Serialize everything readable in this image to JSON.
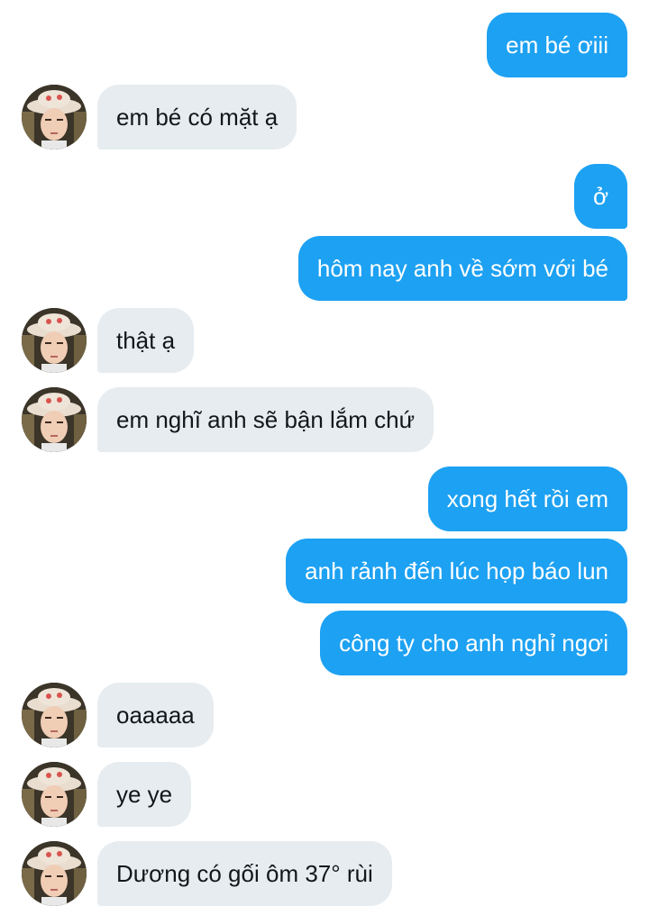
{
  "conversation": {
    "messages": [
      {
        "direction": "outgoing",
        "text": "em bé ơiii"
      },
      {
        "direction": "incoming",
        "text": "em bé có mặt ạ"
      },
      {
        "direction": "outgoing",
        "text": "ở"
      },
      {
        "direction": "outgoing",
        "text": "hôm nay anh về sớm với bé"
      },
      {
        "direction": "incoming",
        "text": "thật ạ"
      },
      {
        "direction": "incoming",
        "text": "em nghĩ anh sẽ bận lắm chứ"
      },
      {
        "direction": "outgoing",
        "text": "xong hết rồi em"
      },
      {
        "direction": "outgoing",
        "text": "anh rảnh đến lúc họp báo lun"
      },
      {
        "direction": "outgoing",
        "text": "công ty cho anh nghỉ ngơi"
      },
      {
        "direction": "incoming",
        "text": "oaaaaa"
      },
      {
        "direction": "incoming",
        "text": "ye ye"
      },
      {
        "direction": "incoming",
        "text": "Dương có gối ôm 37° rùi"
      }
    ]
  },
  "colors": {
    "outgoing_bubble": "#1da1f2",
    "incoming_bubble": "#e6ecf0",
    "incoming_text": "#14171a",
    "outgoing_text": "#ffffff"
  },
  "icons": {
    "avatar": "contact-avatar-photo"
  }
}
